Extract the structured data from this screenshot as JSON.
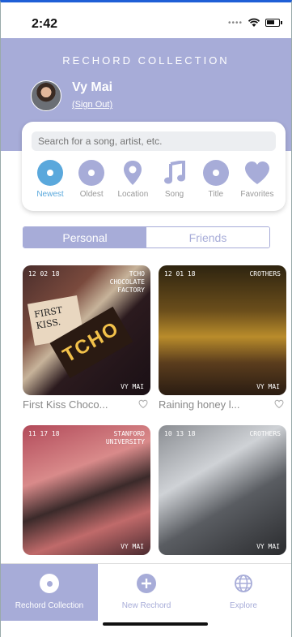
{
  "status": {
    "time": "2:42"
  },
  "header": {
    "title": "RECHORD COLLECTION",
    "user_name": "Vy Mai",
    "sign_out": "(Sign Out)"
  },
  "search": {
    "placeholder": "Search for a song, artist, etc."
  },
  "sort_options": [
    {
      "label": "Newest",
      "icon": "disc-icon",
      "active": true
    },
    {
      "label": "Oldest",
      "icon": "disc-icon"
    },
    {
      "label": "Location",
      "icon": "location-pin-icon"
    },
    {
      "label": "Song",
      "icon": "music-note-icon"
    },
    {
      "label": "Title",
      "icon": "disc-icon"
    },
    {
      "label": "Favorites",
      "icon": "heart-icon"
    }
  ],
  "segment": {
    "personal": "Personal",
    "friends": "Friends",
    "selected": "Personal"
  },
  "cards": [
    {
      "time": "12 02 18",
      "place": "TCHO\nCHOCOLATE\nFACTORY",
      "sig": "VY MAI",
      "caption": "First Kiss Choco...",
      "photo_text_1": "FIRST\nKISS.",
      "photo_text_2": "TCHO"
    },
    {
      "time": "12 01 18",
      "place": "CROTHERS",
      "sig": "VY MAI",
      "caption": "Raining honey l..."
    },
    {
      "time": "11 17 18",
      "place": "STANFORD\nUNIVERSITY",
      "sig": "VY MAI",
      "caption": ""
    },
    {
      "time": "10 13 18",
      "place": "CROTHERS",
      "sig": "VY MAI",
      "caption": ""
    }
  ],
  "tabs": [
    {
      "label": "Rechord Collection",
      "icon": "disc-icon",
      "active": true
    },
    {
      "label": "New Rechord",
      "icon": "plus-circle-icon"
    },
    {
      "label": "Explore",
      "icon": "globe-icon"
    }
  ],
  "colors": {
    "accent": "#a7acd8",
    "active_blue": "#5aa8dc"
  }
}
